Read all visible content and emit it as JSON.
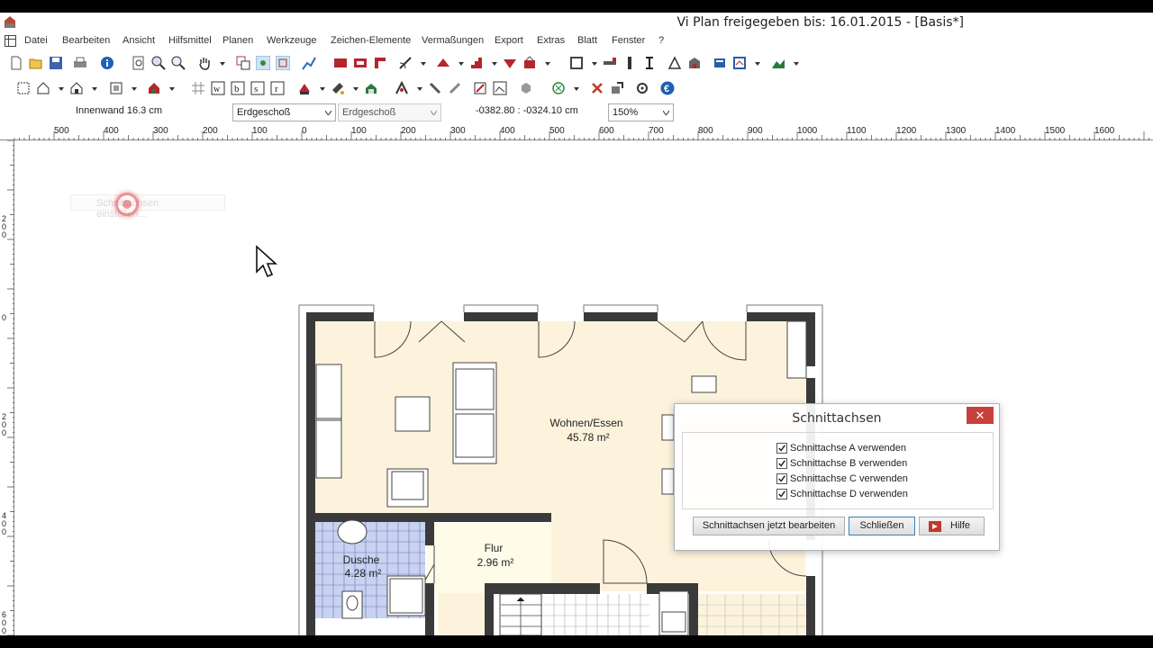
{
  "window": {
    "title": "Vi Plan freigegeben bis: 16.01.2015 - [Basis*]"
  },
  "menu": [
    "Datei",
    "Bearbeiten",
    "Ansicht",
    "Hilfsmittel",
    "Planen",
    "Werkzeuge",
    "Zeichen-Elemente",
    "Vermaßungen",
    "Export",
    "Extras",
    "Blatt",
    "Fenster",
    "?"
  ],
  "status": {
    "element_info": "Innenwand 16.3 cm",
    "floor_select": "Erdgeschoß",
    "floor_select_secondary": "Erdgeschoß",
    "coordinates": "-0382.80 : -0324.10 cm",
    "zoom": "150%"
  },
  "ruler": {
    "corner": "%",
    "h_labels": [
      "500",
      "400",
      "300",
      "200",
      "100",
      "0",
      "100",
      "200",
      "300",
      "400",
      "500",
      "600",
      "700",
      "800",
      "900",
      "1000",
      "1100",
      "1200",
      "1300",
      "1400",
      "1500",
      "1600"
    ],
    "v_labels": [
      "2\n0\n0",
      "0",
      "2\n0\n0",
      "4\n0\n0",
      "6\n0\n0"
    ]
  },
  "canvas": {
    "tooltip": "Schnittachsen einstellen...",
    "rooms": [
      {
        "name": "Wohnen/Essen",
        "area": "45.78 m²"
      },
      {
        "name": "Dusche",
        "area": "4.28 m²"
      },
      {
        "name": "Flur",
        "area": "2.96 m²"
      }
    ]
  },
  "dialog": {
    "title": "Schnittachsen",
    "close": "✕",
    "checkboxes": [
      {
        "label": "Schnittachse A verwenden",
        "checked": true
      },
      {
        "label": "Schnittachse B verwenden",
        "checked": true
      },
      {
        "label": "Schnittachse C verwenden",
        "checked": true
      },
      {
        "label": "Schnittachse D verwenden",
        "checked": true
      }
    ],
    "buttons": {
      "edit": "Schnittachsen jetzt bearbeiten",
      "close": "Schließen",
      "help": "Hilfe"
    }
  },
  "colors": {
    "floor": "#fdf3dc",
    "wall": "#3a3a3a",
    "tile": "#c9d2f0",
    "close_button": "#c9403a"
  }
}
